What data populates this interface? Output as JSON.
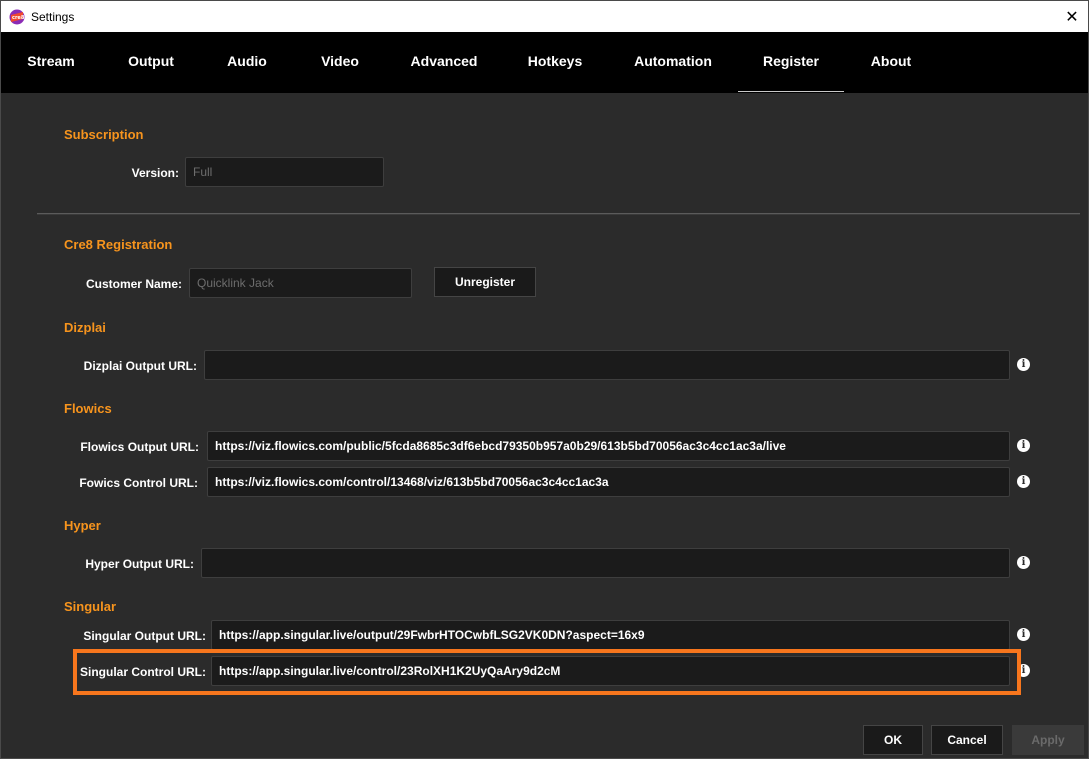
{
  "window": {
    "title": "Settings",
    "close_label": "✕"
  },
  "tabs": [
    {
      "label": "Stream"
    },
    {
      "label": "Output"
    },
    {
      "label": "Audio"
    },
    {
      "label": "Video"
    },
    {
      "label": "Advanced"
    },
    {
      "label": "Hotkeys"
    },
    {
      "label": "Automation"
    },
    {
      "label": "Register"
    },
    {
      "label": "About"
    }
  ],
  "active_tab": "Register",
  "subscription": {
    "title": "Subscription",
    "version_label": "Version:",
    "version_value": "Full"
  },
  "cre8": {
    "title": "Cre8 Registration",
    "customer_label": "Customer Name:",
    "customer_value": "Quicklink Jack",
    "unregister_label": "Unregister"
  },
  "dizplai": {
    "title": "Dizplai",
    "output_label": "Dizplai Output URL:",
    "output_value": ""
  },
  "flowics": {
    "title": "Flowics",
    "output_label": "Flowics Output URL:",
    "output_value": "https://viz.flowics.com/public/5fcda8685c3df6ebcd79350b957a0b29/613b5bd70056ac3c4cc1ac3a/live",
    "control_label": "Fowics Control URL:",
    "control_value": "https://viz.flowics.com/control/13468/viz/613b5bd70056ac3c4cc1ac3a"
  },
  "hyper": {
    "title": "Hyper",
    "output_label": "Hyper Output URL:",
    "output_value": ""
  },
  "singular": {
    "title": "Singular",
    "output_label": "Singular Output URL:",
    "output_value": "https://app.singular.live/output/29FwbrHTOCwbfLSG2VK0DN?aspect=16x9",
    "control_label": "Singular Control URL:",
    "control_value": "https://app.singular.live/control/23RolXH1K2UyQaAry9d2cM"
  },
  "footer": {
    "ok_label": "OK",
    "cancel_label": "Cancel",
    "apply_label": "Apply"
  },
  "colors": {
    "accent": "#f7941d",
    "highlight": "#f7761d",
    "background": "#2b2b2b",
    "tabbar": "#000000"
  }
}
